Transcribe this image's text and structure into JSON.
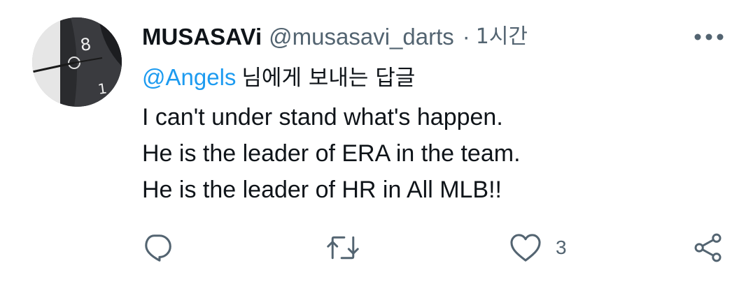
{
  "tweet": {
    "author": {
      "display_name": "MUSASAVi",
      "handle": "@musasavi_darts",
      "avatar_icon": "dartboard-photo"
    },
    "separator": "·",
    "time": "1시간",
    "reply_to": {
      "mention": "@Angels",
      "suffix": "님에게 보내는 답글"
    },
    "body_lines": [
      "I can't under stand what's happen.",
      "He is the leader of ERA in the team.",
      "He is the leader of HR in All MLB!!"
    ],
    "actions": {
      "reply": {
        "icon": "reply-icon",
        "count": ""
      },
      "retweet": {
        "icon": "retweet-icon",
        "count": ""
      },
      "like": {
        "icon": "heart-icon",
        "count": "3"
      },
      "share": {
        "icon": "share-icon",
        "count": ""
      }
    },
    "more_icon": "more-options-icon"
  },
  "colors": {
    "text": "#0f1419",
    "secondary": "#536471",
    "link": "#1d9bf0",
    "background": "#ffffff"
  }
}
